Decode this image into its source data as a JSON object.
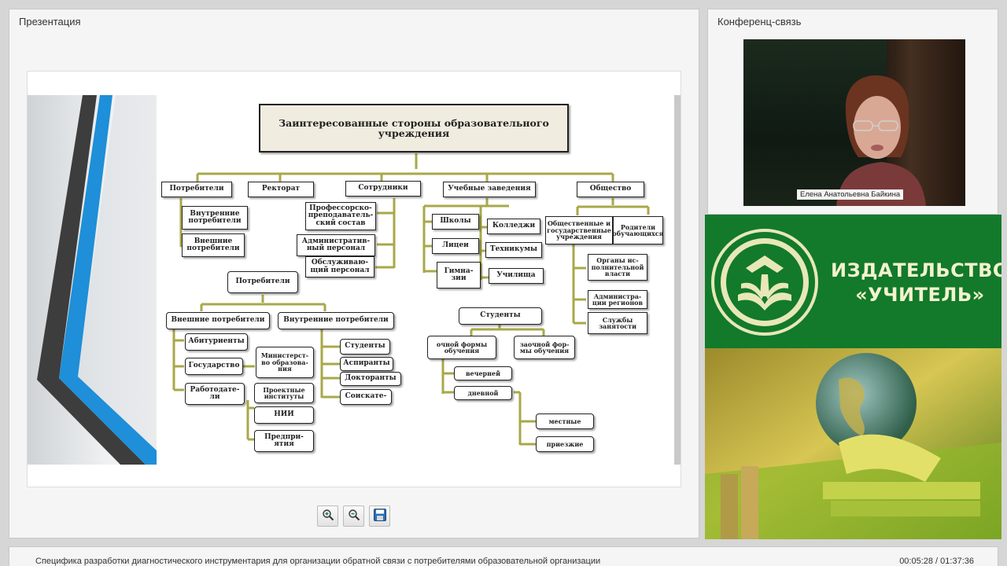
{
  "presentation": {
    "title": "Презентация",
    "slide": {
      "heading": "Заинтересованные стороны образовательного учреждения",
      "top": {
        "consumers": "Потребители",
        "rectorate": "Ректорат",
        "employees": "Сотрудники",
        "institutions": "Учебные заведения",
        "society": "Общество"
      },
      "consumers_sub": {
        "internal": "Внутренние\nпотребители",
        "external": "Внешние\nпотребители"
      },
      "employees_sub": {
        "faculty": "Профессорско-\nпреподаватель-\nский состав",
        "admin": "Административ-\nный персонал",
        "service": "Обслуживаю-\nщий персонал"
      },
      "institutions_sub": {
        "schools": "Школы",
        "colleges": "Колледжи",
        "lyceum": "Лицеи",
        "technical": "Техникумы",
        "gymnasium": "Гимна-\nзии",
        "vocational": "Училища"
      },
      "society_sub": {
        "public": "Общественные и\nгосударственные\nучреждения",
        "parents": "Родители\nобучающихся",
        "executive": "Органы ис-\nполнительной\nвласти",
        "regional": "Администра-\nции регионов",
        "employment": "Службы\nзанятости"
      },
      "consumers_tree": {
        "root": "Потребители",
        "external": "Внешние потребители",
        "internal": "Внутренние потребители",
        "applicants": "Абитуриенты",
        "state": "Государство",
        "ministry": "Министерст-\nво образова-\nния",
        "employers": "Работодате-\nли",
        "design": "Проектные\nинституты",
        "nii": "НИИ",
        "enterprises": "Предпри-\nятия",
        "students": "Студенты",
        "postgrads": "Аспиранты",
        "doctoral": "Докторанты",
        "applicants_deg": "Соискате-"
      },
      "students_tree": {
        "root": "Студенты",
        "fulltime": "очной формы\nобучения",
        "parttime": "заочной фор-\nмы обучения",
        "evening": "вечерней",
        "day": "дневной",
        "local": "местные",
        "incoming": "приезжие"
      }
    }
  },
  "conference": {
    "title": "Конференц-связь",
    "speaker": "Елена Анатольевна Байкина"
  },
  "publisher": {
    "line1": "ИЗДАТЕЛЬСТВО",
    "line2": "«УЧИТЕЛЬ»"
  },
  "footer": {
    "title": "Специфика разработки диагностического инструментария для организации обратной связи с потребителями образовательной организации",
    "time": "00:05:28 / 01:37:36"
  },
  "icons": [
    "zoom-in-icon",
    "zoom-out-icon",
    "save-icon"
  ],
  "colors": {
    "publisher_green": "#127a2a",
    "connector": "#a8a84a",
    "accent_blue": "#1e8fd8"
  }
}
